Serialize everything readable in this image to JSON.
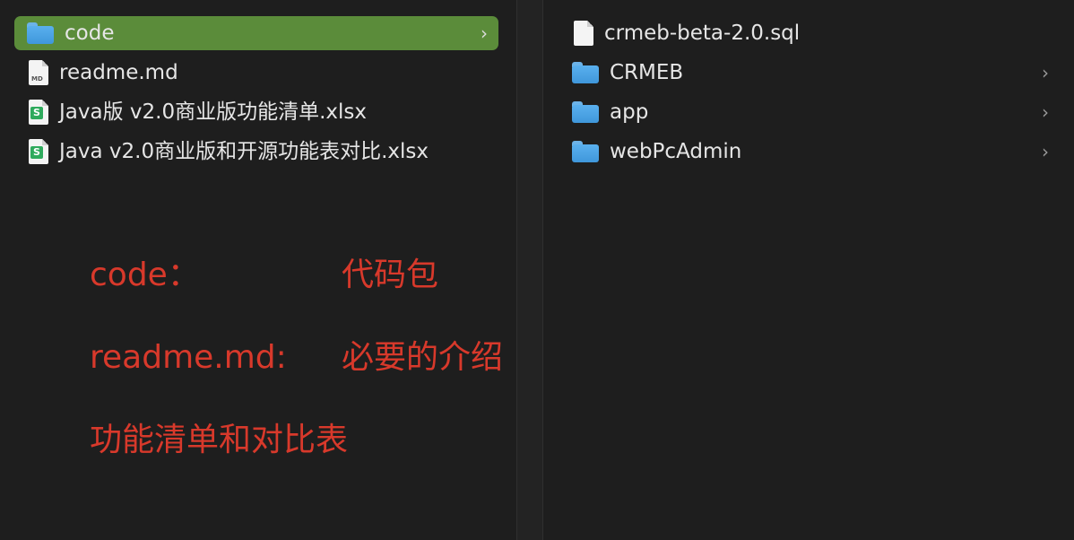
{
  "left_pane": {
    "items": [
      {
        "label": "code",
        "icon": "folder-icon",
        "selected": true
      },
      {
        "label": "readme.md",
        "icon": "markdown-file-icon",
        "badge": "MD"
      },
      {
        "label": "Java版 v2.0商业版功能清单.xlsx",
        "icon": "spreadsheet-file-icon",
        "badge": "S"
      },
      {
        "label": "Java v2.0商业版和开源功能表对比.xlsx",
        "icon": "spreadsheet-file-icon",
        "badge": "S"
      }
    ],
    "chevron": "›"
  },
  "right_pane": {
    "items": [
      {
        "label": "crmeb-beta-2.0.sql",
        "icon": "document-file-icon"
      },
      {
        "label": "CRMEB",
        "icon": "folder-icon"
      },
      {
        "label": "app",
        "icon": "folder-icon"
      },
      {
        "label": "webPcAdmin",
        "icon": "folder-icon"
      }
    ],
    "chevron": "›"
  },
  "annotations": {
    "code_key": "code：",
    "code_value": "代码包",
    "readme_key": "readme.md:",
    "readme_value": "必要的介绍",
    "tables_note": "功能清单和对比表"
  },
  "colors": {
    "background": "#1e1e1e",
    "selection": "#5b8c3a",
    "annotation": "#d8392b",
    "folder": "#4aa3e6",
    "spreadsheet": "#2eaa5c"
  }
}
